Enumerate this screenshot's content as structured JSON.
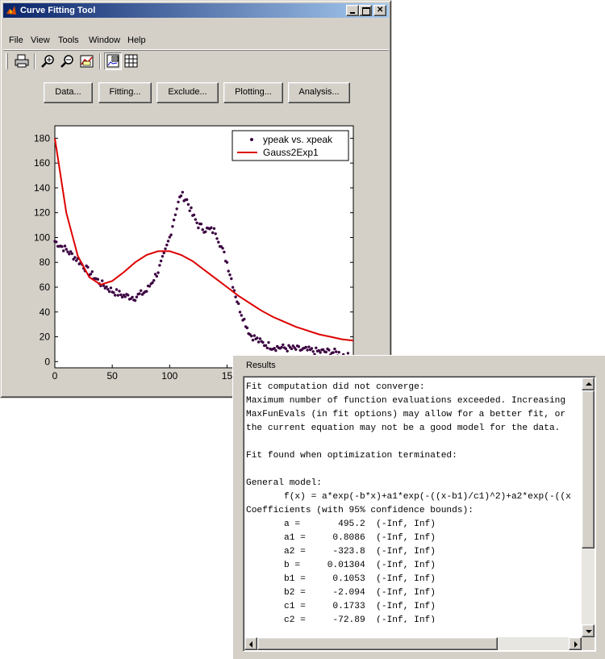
{
  "main_window": {
    "title": "Curve Fitting Tool",
    "menu": [
      "File",
      "View",
      "Tools",
      "Window",
      "Help"
    ],
    "toolbar_icons": [
      "print-icon",
      "zoom-in-icon",
      "zoom-out-icon",
      "data-cursor-icon",
      "legend-icon",
      "grid-icon"
    ],
    "buttons": [
      "Data...",
      "Fitting...",
      "Exclude...",
      "Plotting...",
      "Analysis..."
    ]
  },
  "results": {
    "label": "Results",
    "lines": [
      "Fit computation did not converge:",
      "Maximum number of function evaluations exceeded. Increasing",
      "MaxFunEvals (in fit options) may allow for a better fit, or",
      "the current equation may not be a good model for the data.",
      "",
      "Fit found when optimization terminated:",
      "",
      "General model:",
      "       f(x) = a*exp(-b*x)+a1*exp(-((x-b1)/c1)^2)+a2*exp(-((x",
      "Coefficients (with 95% confidence bounds):",
      "       a =       495.2  (-Inf, Inf)",
      "       a1 =     0.8086  (-Inf, Inf)",
      "       a2 =     -323.8  (-Inf, Inf)",
      "       b =     0.01304  (-Inf, Inf)",
      "       b1 =     0.1053  (-Inf, Inf)",
      "       b2 =     -2.094  (-Inf, Inf)",
      "       c1 =     0.1733  (-Inf, Inf)",
      "       c2 =     -72.89  (-Inf, Inf)"
    ]
  },
  "chart_data": {
    "type": "scatter",
    "x_ticks": [
      "0",
      "50",
      "100",
      "15"
    ],
    "y_ticks": [
      "0",
      "20",
      "40",
      "60",
      "80",
      "100",
      "120",
      "140",
      "160",
      "180"
    ],
    "xlim": [
      0,
      260
    ],
    "ylim": [
      -5,
      190
    ],
    "legend_position": "top-right",
    "series": [
      {
        "name": "ypeak vs. xpeak",
        "style": "dots",
        "color": "#3a0040",
        "x": [
          0,
          10,
          20,
          30,
          40,
          50,
          60,
          70,
          80,
          90,
          95,
          100,
          105,
          110,
          115,
          120,
          125,
          130,
          140,
          150,
          160,
          170,
          180,
          190,
          200,
          210,
          220,
          230,
          240,
          250,
          258
        ],
        "y": [
          97,
          90,
          82,
          72,
          63,
          57,
          53,
          52,
          57,
          73,
          85,
          100,
          120,
          135,
          130,
          118,
          110,
          107,
          105,
          80,
          45,
          22,
          15,
          12,
          11,
          10,
          9,
          8,
          8,
          6,
          3
        ]
      },
      {
        "name": "Gauss2Exp1",
        "style": "line",
        "color": "#dd0000",
        "x": [
          0,
          10,
          20,
          30,
          40,
          50,
          60,
          70,
          80,
          90,
          100,
          110,
          120,
          130,
          140,
          150,
          160,
          170,
          180,
          190,
          200,
          210,
          220,
          230,
          240,
          250,
          260
        ],
        "y": [
          180,
          120,
          85,
          68,
          62,
          65,
          72,
          80,
          86,
          89,
          89,
          86,
          81,
          74,
          67,
          60,
          53,
          47,
          41,
          36,
          32,
          28,
          25,
          22,
          20,
          18,
          17
        ]
      }
    ]
  }
}
